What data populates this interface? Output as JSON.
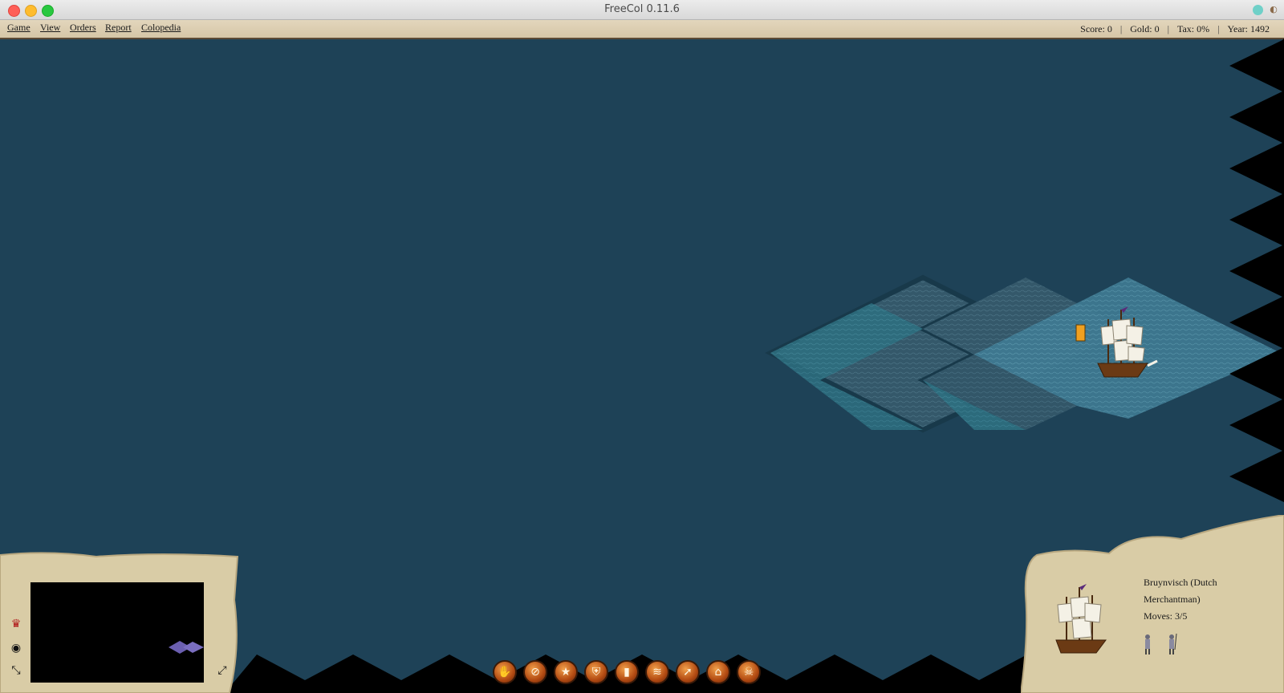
{
  "window": {
    "title": "FreeCol 0.11.6"
  },
  "menu": {
    "items": [
      {
        "label": "Game"
      },
      {
        "label": "View"
      },
      {
        "label": "Orders"
      },
      {
        "label": "Report"
      },
      {
        "label": "Colopedia"
      }
    ]
  },
  "status": {
    "score": "Score: 0",
    "gold": "Gold: 0",
    "tax": "Tax: 0%",
    "year": "Year: 1492",
    "separator": "|"
  },
  "unit_panel": {
    "name": "Bruynvisch (Dutch Merchantman)",
    "moves": "Moves: 3/5"
  },
  "left_panel": {
    "icons": [
      "crown-icon",
      "eye-icon",
      "shrink-icon",
      "expand-icon"
    ]
  },
  "order_buttons": [
    {
      "icon": "hand-icon",
      "glyph": "✋"
    },
    {
      "icon": "no-order-icon",
      "glyph": "⊘"
    },
    {
      "icon": "star-icon",
      "glyph": "★"
    },
    {
      "icon": "fortify-shield-icon",
      "glyph": "⛨"
    },
    {
      "icon": "sentry-icon",
      "glyph": "▮"
    },
    {
      "icon": "plow-icon",
      "glyph": "≋"
    },
    {
      "icon": "road-icon",
      "glyph": "➚"
    },
    {
      "icon": "build-colony-icon",
      "glyph": "⌂"
    },
    {
      "icon": "disband-skull-icon",
      "glyph": "☠"
    }
  ],
  "colors": {
    "ocean": "#1e4257",
    "parchment": "#d9cca6",
    "explored_sea": "#2f6a7e"
  }
}
